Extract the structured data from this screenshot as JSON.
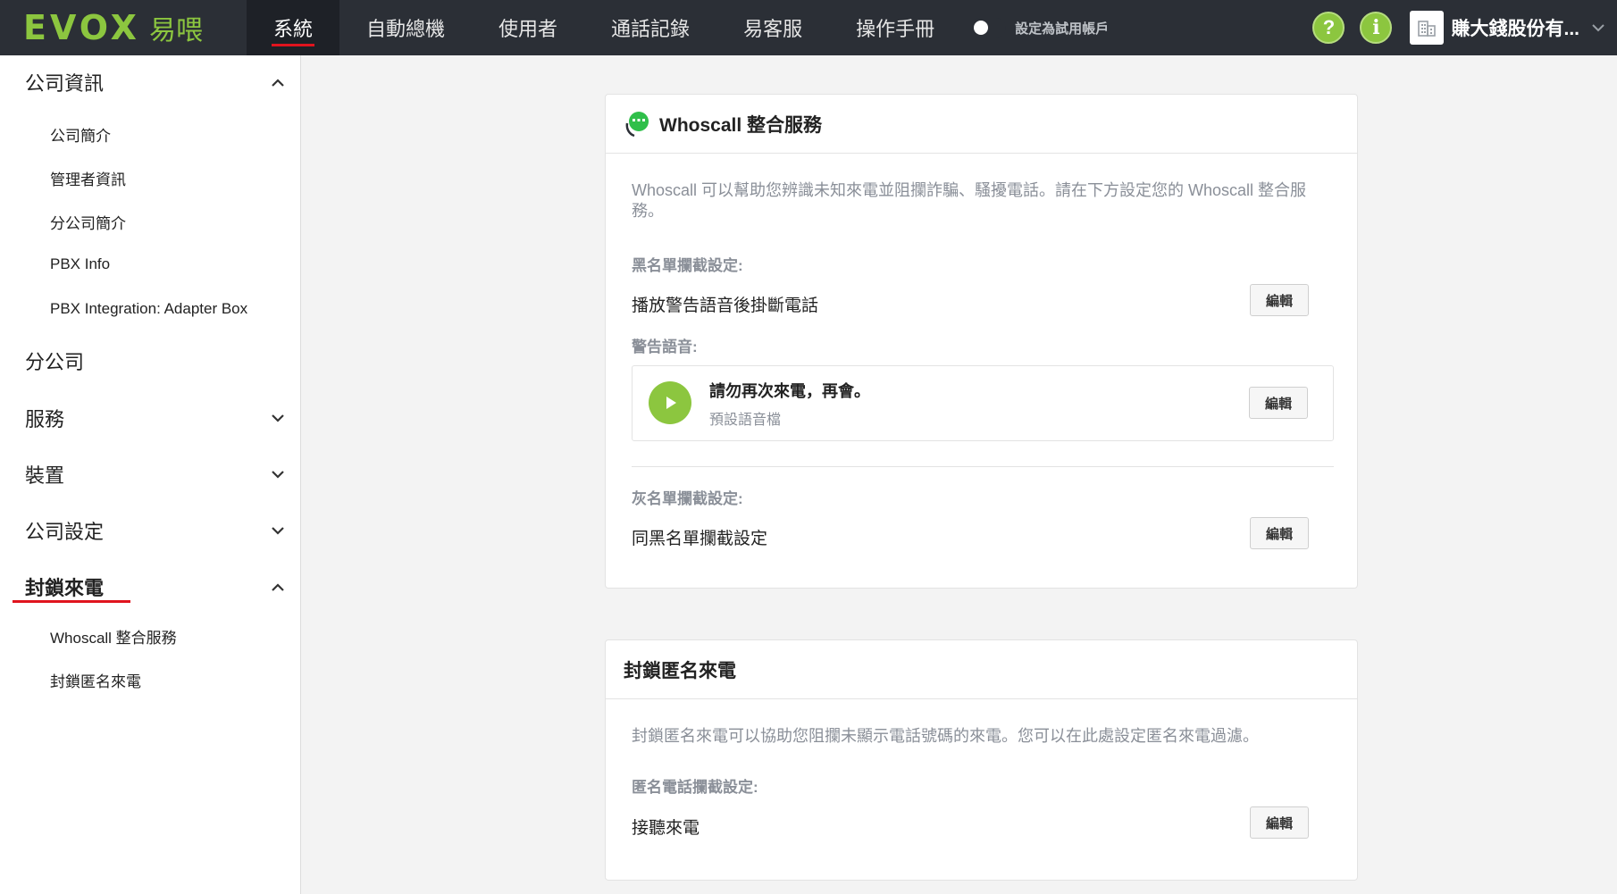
{
  "brand": {
    "name_en": "EVOX",
    "name_zh": "易喂"
  },
  "nav": {
    "items": [
      {
        "label": "系統",
        "active": true
      },
      {
        "label": "自動總機"
      },
      {
        "label": "使用者"
      },
      {
        "label": "通話記錄"
      },
      {
        "label": "易客服"
      },
      {
        "label": "操作手冊"
      }
    ],
    "trial_label": "設定為試用帳戶",
    "help_icon": "?",
    "info_icon": "i",
    "company_name": "賺大錢股份有..."
  },
  "sidebar": {
    "company_info": {
      "label": "公司資訊",
      "items": [
        "公司簡介",
        "管理者資訊",
        "分公司簡介",
        "PBX Info",
        "PBX Integration: Adapter Box"
      ]
    },
    "branch": {
      "label": "分公司"
    },
    "service": {
      "label": "服務"
    },
    "device": {
      "label": "裝置"
    },
    "company_settings": {
      "label": "公司設定"
    },
    "block_calls": {
      "label": "封鎖來電",
      "items": [
        "Whoscall 整合服務",
        "封鎖匿名來電"
      ]
    }
  },
  "whoscall": {
    "title": "Whoscall 整合服務",
    "description": "Whoscall 可以幫助您辨識未知來電並阻攔詐騙、騷擾電話。請在下方設定您的 Whoscall 整合服務。",
    "blacklist_label": "黑名單攔截設定:",
    "blacklist_value": "播放警告語音後掛斷電話",
    "warning_label": "警告語音:",
    "warning_audio_title": "請勿再次來電，再會。",
    "warning_audio_sub": "預設語音檔",
    "graylist_label": "灰名單攔截設定:",
    "graylist_value": "同黑名單攔截設定",
    "edit_label": "編輯"
  },
  "anonymous": {
    "title": "封鎖匿名來電",
    "description": "封鎖匿名來電可以協助您阻攔未顯示電話號碼的來電。您可以在此處設定匿名來電過濾。",
    "setting_label": "匿名電話攔截設定:",
    "setting_value": "接聽來電",
    "edit_label": "編輯"
  },
  "colors": {
    "accent_green": "#8cc63f",
    "accent_red": "#e0141e",
    "topbar": "#2b2f36"
  }
}
